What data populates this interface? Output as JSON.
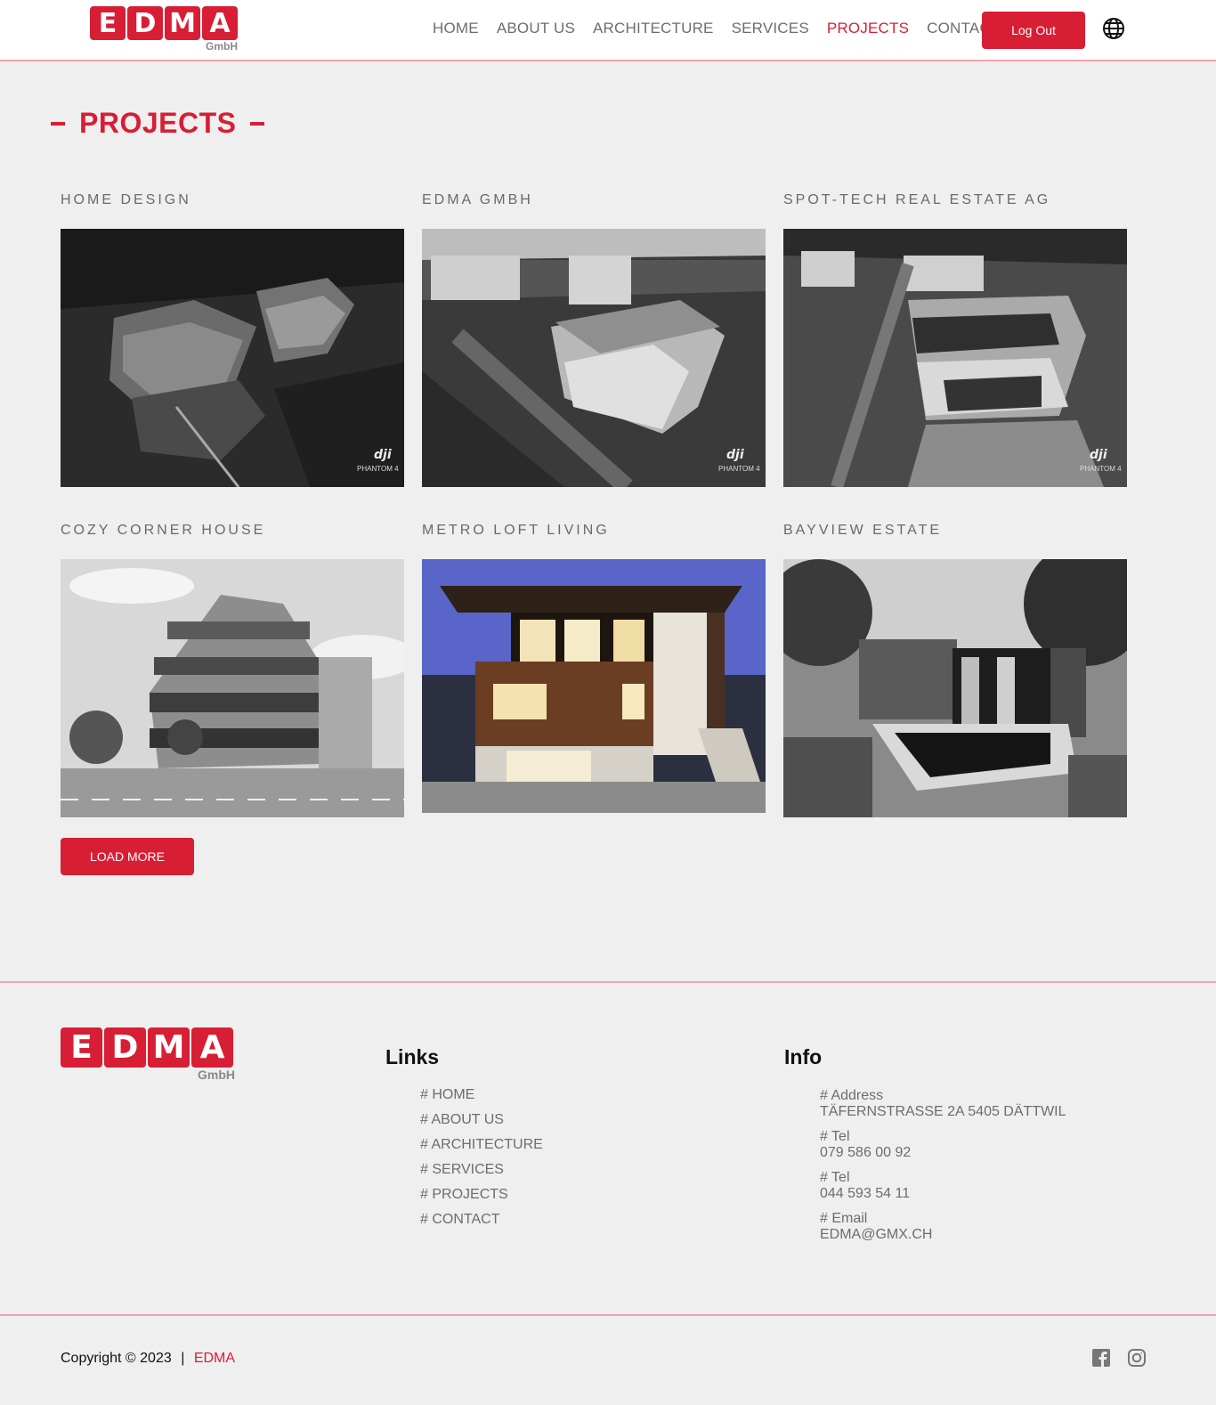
{
  "brand": {
    "logo_letters": [
      "E",
      "D",
      "M",
      "A"
    ],
    "logo_sub": "GmbH",
    "primary_color": "#d81e34"
  },
  "nav": {
    "items": [
      "HOME",
      "ABOUT US",
      "ARCHITECTURE",
      "SERVICES",
      "PROJECTS",
      "CONTACT"
    ],
    "active": "PROJECTS",
    "logout_label": "Log Out",
    "language_icon": "globe-icon"
  },
  "page": {
    "title": "PROJECTS"
  },
  "projects": [
    {
      "title": "HOME DESIGN"
    },
    {
      "title": "EDMA GMBH"
    },
    {
      "title": "SPOT-TECH REAL ESTATE AG"
    },
    {
      "title": "COZY CORNER HOUSE"
    },
    {
      "title": "METRO LOFT LIVING"
    },
    {
      "title": "BAYVIEW ESTATE"
    }
  ],
  "drone_watermark": {
    "logo": "dji",
    "model": "PHANTOM 4"
  },
  "load_more_label": "LOAD MORE",
  "footer": {
    "links_heading": "Links",
    "links": [
      "# HOME",
      "# ABOUT US",
      "# ARCHITECTURE",
      "# SERVICES",
      "# PROJECTS",
      "# CONTACT"
    ],
    "info_heading": "Info",
    "info": [
      {
        "label": "# Address",
        "value": "TÄFERNSTRASSE 2A 5405 DÄTTWIL"
      },
      {
        "label": "# Tel",
        "value": "079 586 00 92"
      },
      {
        "label": "# Tel",
        "value": "044 593 54 11"
      },
      {
        "label": "# Email",
        "value": "EDMA@GMX.CH"
      }
    ],
    "copyright_text": "Copyright © 2023",
    "separator": "|",
    "copyright_brand": "EDMA",
    "social_icons": [
      "facebook-icon",
      "instagram-icon"
    ]
  }
}
